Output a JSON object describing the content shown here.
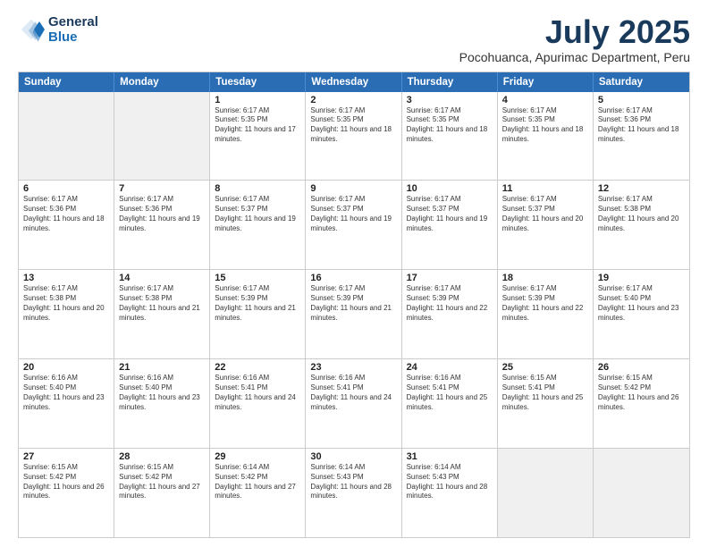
{
  "logo": {
    "line1": "General",
    "line2": "Blue"
  },
  "header": {
    "month": "July 2025",
    "location": "Pocohuanca, Apurimac Department, Peru"
  },
  "weekdays": [
    "Sunday",
    "Monday",
    "Tuesday",
    "Wednesday",
    "Thursday",
    "Friday",
    "Saturday"
  ],
  "weeks": [
    [
      {
        "day": "",
        "info": "",
        "shaded": true
      },
      {
        "day": "",
        "info": "",
        "shaded": true
      },
      {
        "day": "1",
        "info": "Sunrise: 6:17 AM\nSunset: 5:35 PM\nDaylight: 11 hours and 17 minutes."
      },
      {
        "day": "2",
        "info": "Sunrise: 6:17 AM\nSunset: 5:35 PM\nDaylight: 11 hours and 18 minutes."
      },
      {
        "day": "3",
        "info": "Sunrise: 6:17 AM\nSunset: 5:35 PM\nDaylight: 11 hours and 18 minutes."
      },
      {
        "day": "4",
        "info": "Sunrise: 6:17 AM\nSunset: 5:35 PM\nDaylight: 11 hours and 18 minutes."
      },
      {
        "day": "5",
        "info": "Sunrise: 6:17 AM\nSunset: 5:36 PM\nDaylight: 11 hours and 18 minutes."
      }
    ],
    [
      {
        "day": "6",
        "info": "Sunrise: 6:17 AM\nSunset: 5:36 PM\nDaylight: 11 hours and 18 minutes."
      },
      {
        "day": "7",
        "info": "Sunrise: 6:17 AM\nSunset: 5:36 PM\nDaylight: 11 hours and 19 minutes."
      },
      {
        "day": "8",
        "info": "Sunrise: 6:17 AM\nSunset: 5:37 PM\nDaylight: 11 hours and 19 minutes."
      },
      {
        "day": "9",
        "info": "Sunrise: 6:17 AM\nSunset: 5:37 PM\nDaylight: 11 hours and 19 minutes."
      },
      {
        "day": "10",
        "info": "Sunrise: 6:17 AM\nSunset: 5:37 PM\nDaylight: 11 hours and 19 minutes."
      },
      {
        "day": "11",
        "info": "Sunrise: 6:17 AM\nSunset: 5:37 PM\nDaylight: 11 hours and 20 minutes."
      },
      {
        "day": "12",
        "info": "Sunrise: 6:17 AM\nSunset: 5:38 PM\nDaylight: 11 hours and 20 minutes."
      }
    ],
    [
      {
        "day": "13",
        "info": "Sunrise: 6:17 AM\nSunset: 5:38 PM\nDaylight: 11 hours and 20 minutes."
      },
      {
        "day": "14",
        "info": "Sunrise: 6:17 AM\nSunset: 5:38 PM\nDaylight: 11 hours and 21 minutes."
      },
      {
        "day": "15",
        "info": "Sunrise: 6:17 AM\nSunset: 5:39 PM\nDaylight: 11 hours and 21 minutes."
      },
      {
        "day": "16",
        "info": "Sunrise: 6:17 AM\nSunset: 5:39 PM\nDaylight: 11 hours and 21 minutes."
      },
      {
        "day": "17",
        "info": "Sunrise: 6:17 AM\nSunset: 5:39 PM\nDaylight: 11 hours and 22 minutes."
      },
      {
        "day": "18",
        "info": "Sunrise: 6:17 AM\nSunset: 5:39 PM\nDaylight: 11 hours and 22 minutes."
      },
      {
        "day": "19",
        "info": "Sunrise: 6:17 AM\nSunset: 5:40 PM\nDaylight: 11 hours and 23 minutes."
      }
    ],
    [
      {
        "day": "20",
        "info": "Sunrise: 6:16 AM\nSunset: 5:40 PM\nDaylight: 11 hours and 23 minutes."
      },
      {
        "day": "21",
        "info": "Sunrise: 6:16 AM\nSunset: 5:40 PM\nDaylight: 11 hours and 23 minutes."
      },
      {
        "day": "22",
        "info": "Sunrise: 6:16 AM\nSunset: 5:41 PM\nDaylight: 11 hours and 24 minutes."
      },
      {
        "day": "23",
        "info": "Sunrise: 6:16 AM\nSunset: 5:41 PM\nDaylight: 11 hours and 24 minutes."
      },
      {
        "day": "24",
        "info": "Sunrise: 6:16 AM\nSunset: 5:41 PM\nDaylight: 11 hours and 25 minutes."
      },
      {
        "day": "25",
        "info": "Sunrise: 6:15 AM\nSunset: 5:41 PM\nDaylight: 11 hours and 25 minutes."
      },
      {
        "day": "26",
        "info": "Sunrise: 6:15 AM\nSunset: 5:42 PM\nDaylight: 11 hours and 26 minutes."
      }
    ],
    [
      {
        "day": "27",
        "info": "Sunrise: 6:15 AM\nSunset: 5:42 PM\nDaylight: 11 hours and 26 minutes."
      },
      {
        "day": "28",
        "info": "Sunrise: 6:15 AM\nSunset: 5:42 PM\nDaylight: 11 hours and 27 minutes."
      },
      {
        "day": "29",
        "info": "Sunrise: 6:14 AM\nSunset: 5:42 PM\nDaylight: 11 hours and 27 minutes."
      },
      {
        "day": "30",
        "info": "Sunrise: 6:14 AM\nSunset: 5:43 PM\nDaylight: 11 hours and 28 minutes."
      },
      {
        "day": "31",
        "info": "Sunrise: 6:14 AM\nSunset: 5:43 PM\nDaylight: 11 hours and 28 minutes."
      },
      {
        "day": "",
        "info": "",
        "shaded": true
      },
      {
        "day": "",
        "info": "",
        "shaded": true
      }
    ]
  ]
}
